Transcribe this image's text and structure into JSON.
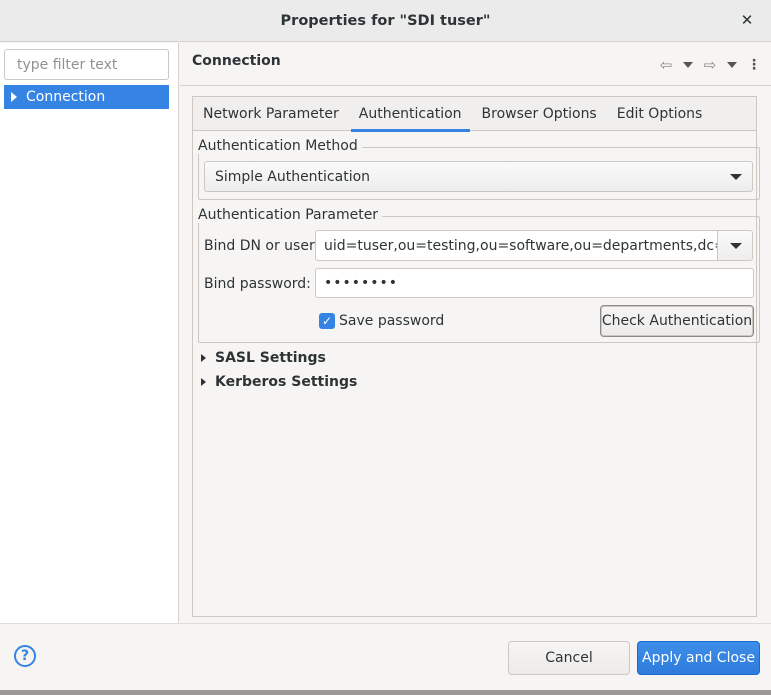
{
  "window": {
    "title": "Properties for \"SDI tuser\"",
    "close_glyph": "✕"
  },
  "left_pane": {
    "filter_placeholder": "type filter text",
    "tree_items": [
      {
        "label": "Connection",
        "selected": true
      }
    ]
  },
  "right_pane": {
    "header": "Connection",
    "nav": {
      "back_icon": "back-arrow-icon",
      "forward_icon": "forward-arrow-icon",
      "menu_icon": "view-menu-icon"
    },
    "tabs": [
      {
        "label": "Network Parameter",
        "active": false
      },
      {
        "label": "Authentication",
        "active": true
      },
      {
        "label": "Browser Options",
        "active": false
      },
      {
        "label": "Edit Options",
        "active": false
      }
    ],
    "auth_method": {
      "legend": "Authentication Method",
      "selected": "Simple Authentication"
    },
    "auth_param": {
      "legend": "Authentication Parameter",
      "bind_dn_label": "Bind DN or user:",
      "bind_dn_value": "uid=tuser,ou=testing,ou=software,ou=departments,dc=betr",
      "password_label": "Bind password:",
      "password_value": "••••••••",
      "save_password_label": "Save password",
      "save_password_checked": true,
      "check_auth_button": "Check Authentication"
    },
    "expanders": [
      {
        "label": "SASL Settings",
        "expanded": false
      },
      {
        "label": "Kerberos Settings",
        "expanded": false
      }
    ]
  },
  "footer": {
    "help_glyph": "?",
    "cancel": "Cancel",
    "apply_close": "Apply and Close"
  },
  "colors": {
    "accent": "#3584e4",
    "background": "#f6f5f4"
  }
}
